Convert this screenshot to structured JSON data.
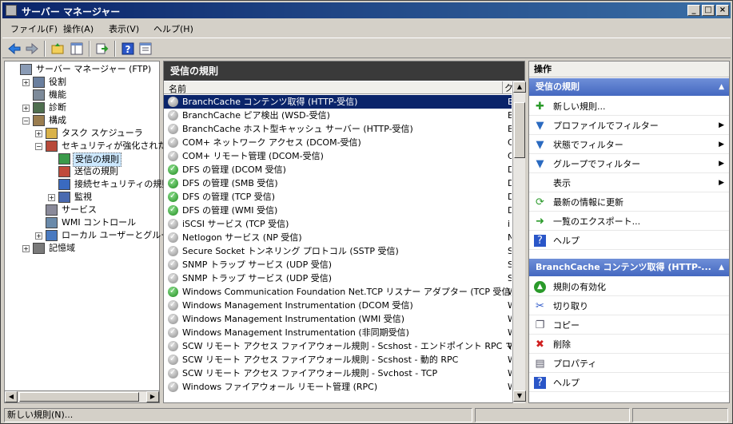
{
  "window": {
    "title": "サーバー マネージャー"
  },
  "menu": [
    "ファイル(F)",
    "操作(A)",
    "表示(V)",
    "ヘルプ(H)"
  ],
  "tree": [
    {
      "label": "サーバー マネージャー (FTP)",
      "level": 0,
      "icon": "server-icon"
    },
    {
      "label": "役割",
      "level": 1,
      "expander": "+",
      "icon": "roles-icon"
    },
    {
      "label": "機能",
      "level": 1,
      "icon": "features-icon"
    },
    {
      "label": "診断",
      "level": 1,
      "expander": "+",
      "icon": "diagnostics-icon"
    },
    {
      "label": "構成",
      "level": 1,
      "expander": "-",
      "icon": "configuration-icon"
    },
    {
      "label": "タスク スケジューラ",
      "level": 2,
      "expander": "+",
      "icon": "clock-icon"
    },
    {
      "label": "セキュリティが強化された Wi",
      "level": 2,
      "expander": "-",
      "icon": "firewall-icon"
    },
    {
      "label": "受信の規則",
      "level": 3,
      "icon": "inbound-rules-icon",
      "selected": true
    },
    {
      "label": "送信の規則",
      "level": 3,
      "icon": "outbound-rules-icon"
    },
    {
      "label": "接続セキュリティの規則",
      "level": 3,
      "icon": "connection-security-icon"
    },
    {
      "label": "監視",
      "level": 3,
      "expander": "+",
      "icon": "monitor-icon"
    },
    {
      "label": "サービス",
      "level": 2,
      "icon": "services-icon"
    },
    {
      "label": "WMI コントロール",
      "level": 2,
      "icon": "wmi-icon"
    },
    {
      "label": "ローカル ユーザーとグループ",
      "level": 2,
      "expander": "+",
      "icon": "users-icon"
    },
    {
      "label": "記憶域",
      "level": 1,
      "expander": "+",
      "icon": "storage-icon"
    }
  ],
  "center": {
    "title": "受信の規則",
    "column_name": "名前",
    "column_group_abbrev": "ク",
    "rows": [
      {
        "name": "BranchCache コンテンツ取得 (HTTP-受信)",
        "status": "gray",
        "group": "B",
        "selected": true
      },
      {
        "name": "BranchCache ピア検出 (WSD-受信)",
        "status": "gray",
        "group": "B"
      },
      {
        "name": "BranchCache ホスト型キャッシュ サーバー (HTTP-受信)",
        "status": "gray",
        "group": "B"
      },
      {
        "name": "COM+ ネットワーク アクセス (DCOM-受信)",
        "status": "gray",
        "group": "C"
      },
      {
        "name": "COM+ リモート管理 (DCOM-受信)",
        "status": "gray",
        "group": "C"
      },
      {
        "name": "DFS の管理 (DCOM 受信)",
        "status": "green",
        "group": "D"
      },
      {
        "name": "DFS の管理 (SMB 受信)",
        "status": "green",
        "group": "D"
      },
      {
        "name": "DFS の管理 (TCP 受信)",
        "status": "green",
        "group": "D"
      },
      {
        "name": "DFS の管理 (WMI 受信)",
        "status": "green",
        "group": "D"
      },
      {
        "name": "iSCSI サービス (TCP 受信)",
        "status": "gray",
        "group": "i"
      },
      {
        "name": "Netlogon サービス (NP 受信)",
        "status": "gray",
        "group": "N"
      },
      {
        "name": "Secure Socket トンネリング プロトコル (SSTP 受信)",
        "status": "gray",
        "group": "S"
      },
      {
        "name": "SNMP トラップ サービス (UDP 受信)",
        "status": "gray",
        "group": "S"
      },
      {
        "name": "SNMP トラップ サービス (UDP 受信)",
        "status": "gray",
        "group": "S"
      },
      {
        "name": "Windows Communication Foundation Net.TCP リスナー アダプター (TCP 受信)",
        "status": "green",
        "group": "W"
      },
      {
        "name": "Windows Management Instrumentation (DCOM 受信)",
        "status": "gray",
        "group": "W"
      },
      {
        "name": "Windows Management Instrumentation (WMI 受信)",
        "status": "gray",
        "group": "W"
      },
      {
        "name": "Windows Management Instrumentation (非同期受信)",
        "status": "gray",
        "group": "W"
      },
      {
        "name": "SCW リモート アクセス ファイアウォール規則 - Scshost - エンドポイント RPC マッパー",
        "status": "gray",
        "group": "W"
      },
      {
        "name": "SCW リモート アクセス ファイアウォール規則 - Scshost - 動的 RPC",
        "status": "gray",
        "group": "W"
      },
      {
        "name": "SCW リモート アクセス ファイアウォール規則 - Svchost - TCP",
        "status": "gray",
        "group": "W"
      },
      {
        "name": "Windows ファイアウォール リモート管理 (RPC)",
        "status": "gray",
        "group": "W"
      }
    ]
  },
  "actions": {
    "title": "操作",
    "section1": "受信の規則",
    "items1": [
      {
        "label": "新しい規則...",
        "icon": "new-rule-icon"
      },
      {
        "label": "プロファイルでフィルター",
        "icon": "filter-icon",
        "submenu": true
      },
      {
        "label": "状態でフィルター",
        "icon": "filter-icon",
        "submenu": true
      },
      {
        "label": "グループでフィルター",
        "icon": "filter-icon",
        "submenu": true
      },
      {
        "label": "表示",
        "icon": "",
        "submenu": true
      },
      {
        "label": "最新の情報に更新",
        "icon": "refresh-icon"
      },
      {
        "label": "一覧のエクスポート...",
        "icon": "export-icon"
      },
      {
        "label": "ヘルプ",
        "icon": "help-icon"
      }
    ],
    "section2": "BranchCache コンテンツ取得 (HTTP-...",
    "items2": [
      {
        "label": "規則の有効化",
        "icon": "enable-icon"
      },
      {
        "label": "切り取り",
        "icon": "cut-icon"
      },
      {
        "label": "コピー",
        "icon": "copy-icon"
      },
      {
        "label": "削除",
        "icon": "delete-icon"
      },
      {
        "label": "プロパティ",
        "icon": "properties-icon"
      },
      {
        "label": "ヘルプ",
        "icon": "help-icon"
      }
    ]
  },
  "status": {
    "text": "新しい規則(N)..."
  },
  "colors": {
    "title_start": "#0a246a",
    "section": "#4468c0",
    "selected_row": "#0a246a"
  }
}
